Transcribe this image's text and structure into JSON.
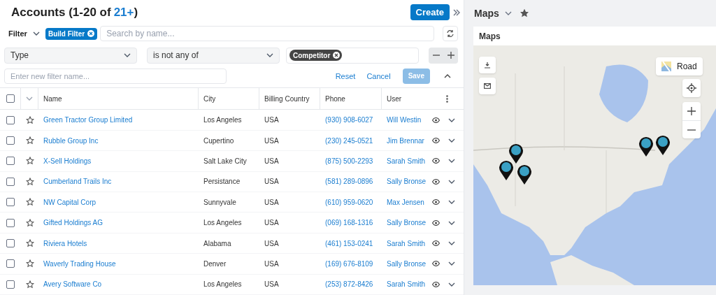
{
  "header": {
    "title": "Accounts (1-20 of",
    "count": "21+",
    "title_end": ")",
    "create_button": "Create"
  },
  "filter_bar": {
    "label": "Filter",
    "chip": "Build Filter",
    "search": {
      "placeholder": "Search by name..."
    }
  },
  "filter_row": {
    "field": "Type",
    "operator": "is not any of",
    "values": [
      "Competitor"
    ]
  },
  "save_row": {
    "name_field": {
      "placeholder": "Enter new filter name..."
    },
    "reset": "Reset",
    "cancel": "Cancel",
    "save": "Save",
    "save_disabled": true
  },
  "table": {
    "select_all_checked": false,
    "columns": [
      "Name",
      "City",
      "Billing Country",
      "Phone",
      "User"
    ],
    "rows": [
      {
        "checked": false,
        "favorite": false,
        "name": "Green Tractor Group Limited",
        "city": "Los Angeles",
        "country": "USA",
        "phone": "(930) 908-6027",
        "user": "Will Westin"
      },
      {
        "checked": false,
        "favorite": false,
        "name": "Rubble Group Inc",
        "city": "Cupertino",
        "country": "USA",
        "phone": "(230) 245-0521",
        "user": "Jim Brennar"
      },
      {
        "checked": false,
        "favorite": false,
        "name": "X-Sell Holdings",
        "city": "Salt Lake City",
        "country": "USA",
        "phone": "(875) 500-2293",
        "user": "Sarah Smith"
      },
      {
        "checked": false,
        "favorite": false,
        "name": "Cumberland Trails Inc",
        "city": "Persistance",
        "country": "USA",
        "phone": "(581) 289-0896",
        "user": "Sally Bronse"
      },
      {
        "checked": false,
        "favorite": false,
        "name": "NW Capital Corp",
        "city": "Sunnyvale",
        "country": "USA",
        "phone": "(610) 959-0620",
        "user": "Max Jensen"
      },
      {
        "checked": false,
        "favorite": false,
        "name": "Gifted Holdings AG",
        "city": "Los Angeles",
        "country": "USA",
        "phone": "(069) 168-1316",
        "user": "Sally Bronse"
      },
      {
        "checked": false,
        "favorite": false,
        "name": "Riviera Hotels",
        "city": "Alabama",
        "country": "USA",
        "phone": "(461) 153-0241",
        "user": "Sarah Smith"
      },
      {
        "checked": false,
        "favorite": false,
        "name": "Waverly Trading House",
        "city": "Denver",
        "country": "USA",
        "phone": "(169) 676-8109",
        "user": "Sally Bronse"
      },
      {
        "checked": false,
        "favorite": false,
        "name": "Avery Software Co",
        "city": "Los Angeles",
        "country": "USA",
        "phone": "(253) 872-8426",
        "user": "Sarah Smith"
      }
    ]
  },
  "dashlet": {
    "title": "Maps",
    "favorite": true,
    "card_title": "Maps",
    "map": {
      "kind": "picture",
      "style_button": "Road"
    }
  }
}
